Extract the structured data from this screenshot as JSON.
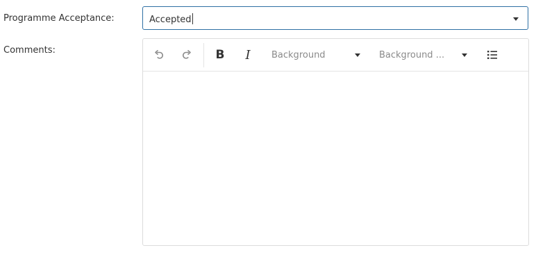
{
  "fields": {
    "acceptance_label": "Programme Acceptance:",
    "acceptance_value": "Accepted",
    "comments_label": "Comments:"
  },
  "editor": {
    "toolbar": {
      "undo_icon": "undo-icon",
      "redo_icon": "redo-icon",
      "bold_label": "B",
      "italic_label": "I",
      "background_color_label": "Background",
      "background_image_label": "Background ...",
      "list_icon": "bulleted-list-icon"
    },
    "content": ""
  },
  "colors": {
    "focus_border": "#2e6fa4",
    "text": "#333333",
    "muted_text": "#8a8a8a",
    "border": "#dcdcdc",
    "icon_disabled": "#8c8c8c"
  }
}
